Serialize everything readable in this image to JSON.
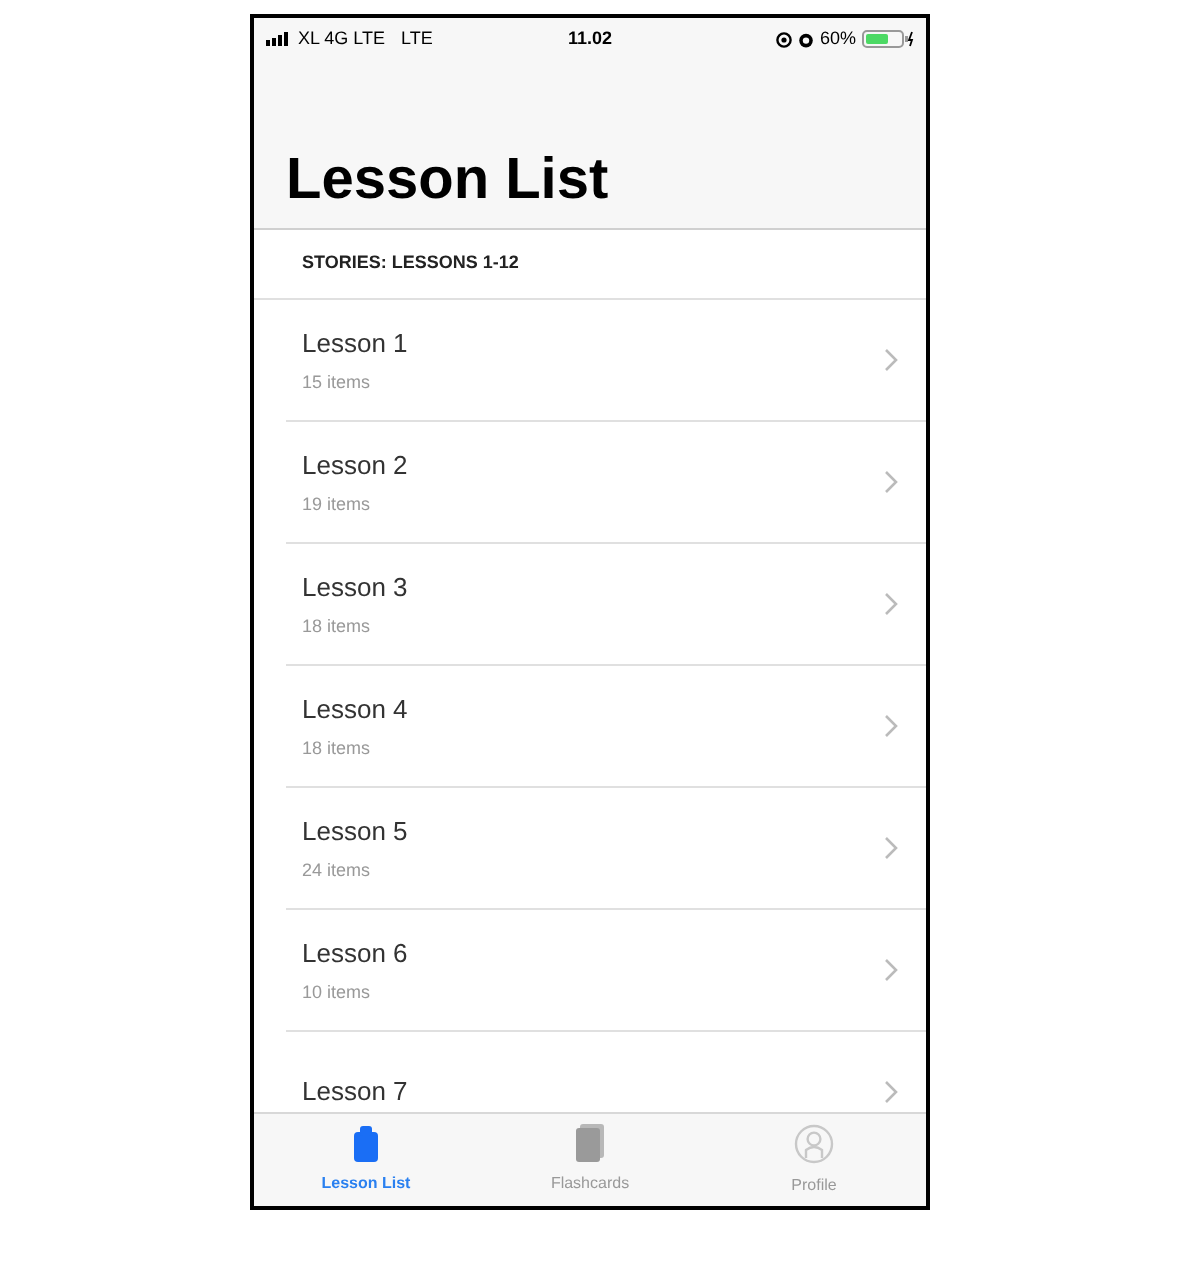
{
  "status_bar": {
    "carrier": "XL 4G LTE",
    "network": "LTE",
    "time": "11.02",
    "battery_percent": "60%"
  },
  "title": "Lesson List",
  "section_header": "STORIES: LESSONS 1-12",
  "lessons": [
    {
      "title": "Lesson 1",
      "subtitle": "15 items"
    },
    {
      "title": "Lesson 2",
      "subtitle": "19 items"
    },
    {
      "title": "Lesson 3",
      "subtitle": "18 items"
    },
    {
      "title": "Lesson 4",
      "subtitle": "18 items"
    },
    {
      "title": "Lesson 5",
      "subtitle": "24 items"
    },
    {
      "title": "Lesson 6",
      "subtitle": "10 items"
    },
    {
      "title": "Lesson 7"
    }
  ],
  "tabs": [
    {
      "label": "Lesson List",
      "kind": "clipboard",
      "selected": true
    },
    {
      "label": "Flashcards",
      "kind": "cards",
      "selected": false
    },
    {
      "label": "Profile",
      "kind": "profile",
      "selected": false
    }
  ]
}
